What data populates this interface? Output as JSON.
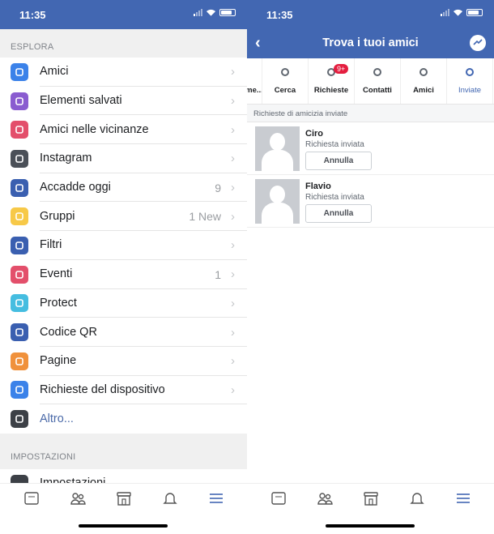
{
  "left": {
    "status": {
      "time": "11:35"
    },
    "explore_header": "ESPLORA",
    "menu": [
      {
        "label": "Amici",
        "icon": "friends-icon",
        "color": "#3b82e9",
        "meta": ""
      },
      {
        "label": "Elementi salvati",
        "icon": "bookmark-icon",
        "color": "#8a5cd0",
        "meta": ""
      },
      {
        "label": "Amici nelle vicinanze",
        "icon": "nearby-icon",
        "color": "#e34f6b",
        "meta": ""
      },
      {
        "label": "Instagram",
        "icon": "instagram-icon",
        "color": "#4b5058",
        "meta": ""
      },
      {
        "label": "Accadde oggi",
        "icon": "memories-icon",
        "color": "#3a5fb0",
        "meta": "9"
      },
      {
        "label": "Gruppi",
        "icon": "groups-icon",
        "color": "#f7c948",
        "meta": "1 New"
      },
      {
        "label": "Filtri",
        "icon": "filters-icon",
        "color": "#3a5fb0",
        "meta": ""
      },
      {
        "label": "Eventi",
        "icon": "calendar-icon",
        "color": "#e34f6b",
        "meta": "1"
      },
      {
        "label": "Protect",
        "icon": "shield-icon",
        "color": "#45bde0",
        "meta": ""
      },
      {
        "label": "Codice QR",
        "icon": "qr-code-icon",
        "color": "#3a5fb0",
        "meta": ""
      },
      {
        "label": "Pagine",
        "icon": "flag-icon",
        "color": "#f0913b",
        "meta": ""
      },
      {
        "label": "Richieste del dispositivo",
        "icon": "device-icon",
        "color": "#3b82e9",
        "meta": ""
      },
      {
        "label": "Altro...",
        "icon": "chevron-down-icon",
        "color": "#3c4046",
        "meta": ""
      }
    ],
    "settings_header": "IMPOSTAZIONI",
    "settings_item": "Impostazioni"
  },
  "right": {
    "status": {
      "time": "11:35"
    },
    "nav": {
      "title": "Trova i tuoi amici"
    },
    "tabs": [
      {
        "label": "me...",
        "icon": ""
      },
      {
        "label": "Cerca",
        "icon": "search-icon"
      },
      {
        "label": "Richieste",
        "icon": "friend-requests-icon",
        "badge": "9+"
      },
      {
        "label": "Contatti",
        "icon": "contacts-icon"
      },
      {
        "label": "Amici",
        "icon": "friends-icon"
      },
      {
        "label": "Inviate",
        "icon": "sent-requests-icon"
      }
    ],
    "section_title": "Richieste di amicizia inviate",
    "requests": [
      {
        "name": "Ciro",
        "status": "Richiesta inviata",
        "action": "Annulla"
      },
      {
        "name": "Flavio",
        "status": "Richiesta inviata",
        "action": "Annulla"
      }
    ]
  },
  "bottom_tabs": [
    "news-feed-icon",
    "friends-icon",
    "marketplace-icon",
    "notifications-icon",
    "menu-icon"
  ],
  "colors": {
    "brand": "#4267b2",
    "badge": "#e41e3f"
  }
}
